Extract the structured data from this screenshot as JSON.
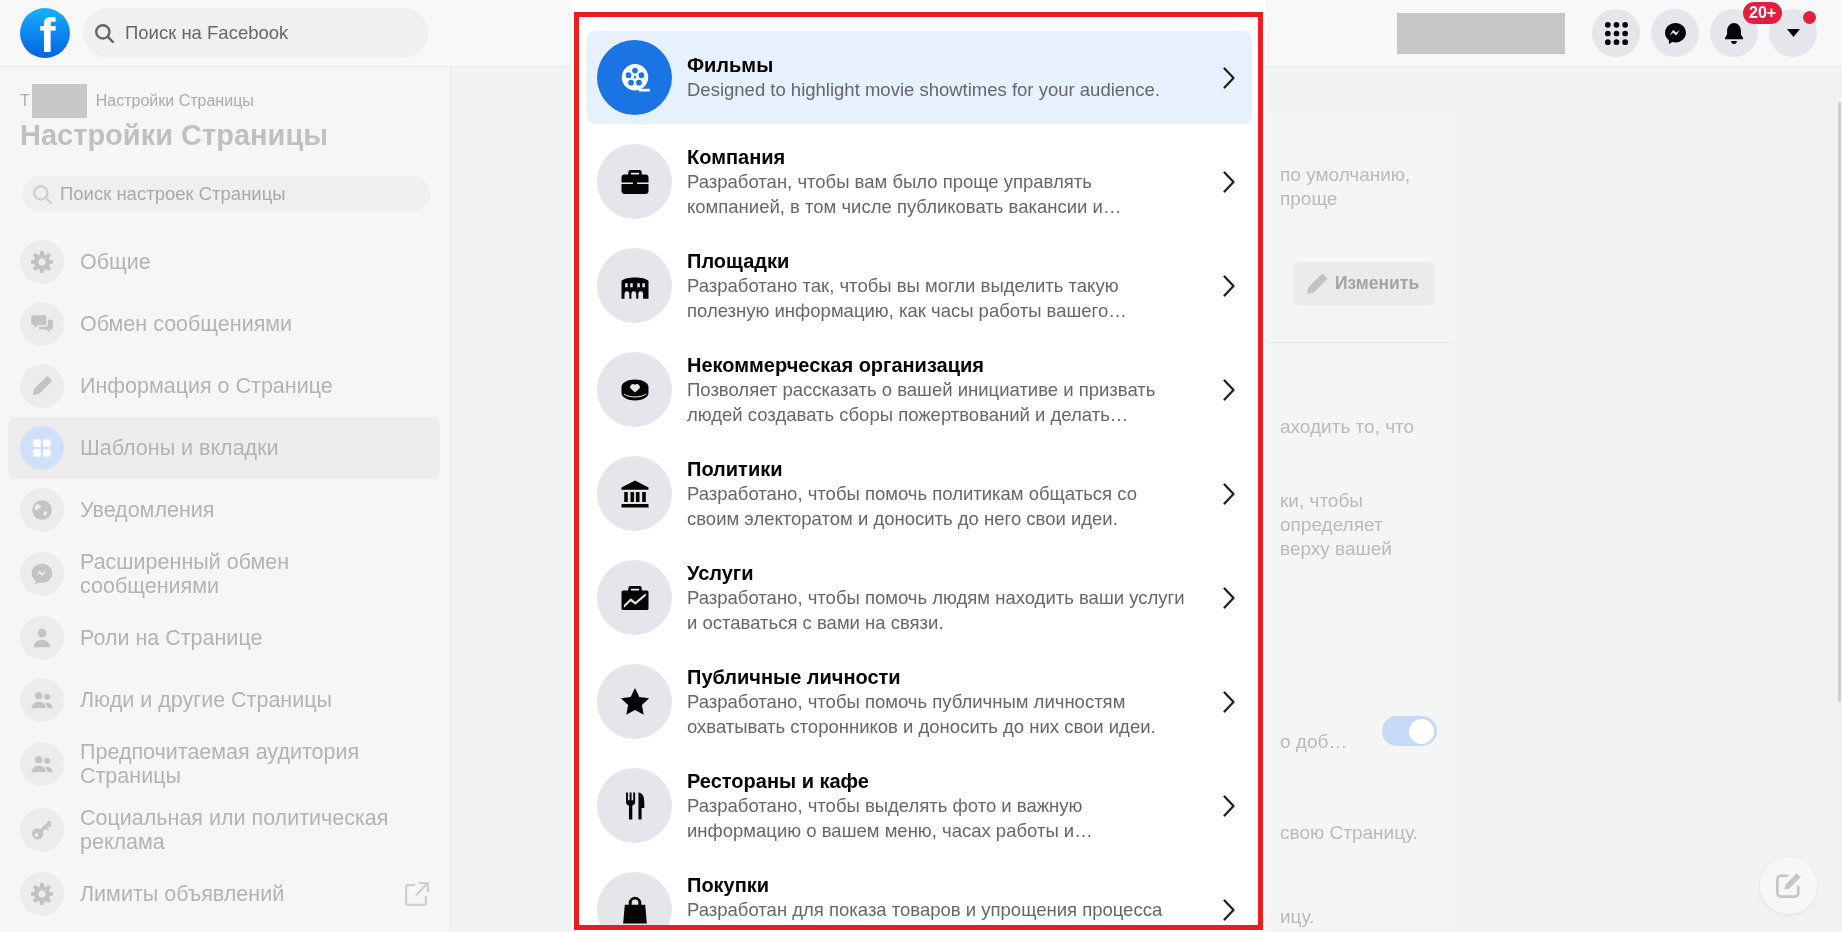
{
  "header": {
    "logo": "f",
    "search_placeholder": "Поиск на Facebook",
    "notifications_badge": "20+",
    "account_dot": true
  },
  "sidebar": {
    "breadcrumb_first": "Т",
    "breadcrumb_current": "Настройки Страницы",
    "title": "Настройки Страницы",
    "search_placeholder": "Поиск настроек Страницы",
    "items": [
      {
        "label": "Общие",
        "selected": false,
        "external": false
      },
      {
        "label": "Обмен сообщениями",
        "selected": false,
        "external": false
      },
      {
        "label": "Информация о Странице",
        "selected": false,
        "external": false
      },
      {
        "label": "Шаблоны и вкладки",
        "selected": true,
        "external": false
      },
      {
        "label": "Уведомления",
        "selected": false,
        "external": false
      },
      {
        "label": "Расширенный обмен сообщениями",
        "selected": false,
        "external": false
      },
      {
        "label": "Роли на Странице",
        "selected": false,
        "external": false
      },
      {
        "label": "Люди и другие Страницы",
        "selected": false,
        "external": false
      },
      {
        "label": "Предпочитаемая аудитория Страницы",
        "selected": false,
        "external": false
      },
      {
        "label": "Социальная или политическая реклама",
        "selected": false,
        "external": false
      },
      {
        "label": "Лимиты объявлений",
        "selected": false,
        "external": true
      }
    ]
  },
  "modal": {
    "categories": [
      {
        "title": "Фильмы",
        "description": "Designed to highlight movie showtimes for your audience.",
        "selected": true
      },
      {
        "title": "Компания",
        "description": "Разработан, чтобы вам было проще управлять компанией, в том числе публиковать вакансии и…",
        "selected": false
      },
      {
        "title": "Площадки",
        "description": "Разработано так, чтобы вы могли выделить такую полезную информацию, как часы работы вашего…",
        "selected": false
      },
      {
        "title": "Некоммерческая организация",
        "description": "Позволяет рассказать о вашей инициативе и призвать людей создавать сборы пожертвований и делать…",
        "selected": false
      },
      {
        "title": "Политики",
        "description": "Разработано, чтобы помочь политикам общаться со своим электоратом и доносить до него свои идеи.",
        "selected": false
      },
      {
        "title": "Услуги",
        "description": "Разработано, чтобы помочь людям находить ваши услуги и оставаться с вами на связи.",
        "selected": false
      },
      {
        "title": "Публичные личности",
        "description": "Разработано, чтобы помочь публичным личностям охватывать сторонников и доносить до них свои идеи.",
        "selected": false
      },
      {
        "title": "Рестораны и кафе",
        "description": "Разработано, чтобы выделять фото и важную информацию о вашем меню, часах работы и…",
        "selected": false
      },
      {
        "title": "Покупки",
        "description": "Разработан для показа товаров и упрощения процесса",
        "selected": false
      }
    ]
  },
  "settings_card": {
    "sections": [
      {
        "lines": [
          "по умолчанию,",
          "проще"
        ],
        "button": "Изменить"
      },
      {
        "lines": [
          "аходить то, что"
        ]
      },
      {
        "lines": [
          "ки, чтобы",
          "определяет",
          "верху вашей"
        ]
      },
      {
        "lines": [
          "о доб…"
        ],
        "toggle": {
          "on": true
        }
      },
      {
        "lines": [
          "свою Страницу."
        ]
      },
      {
        "lines": [
          "ицу."
        ]
      }
    ]
  }
}
